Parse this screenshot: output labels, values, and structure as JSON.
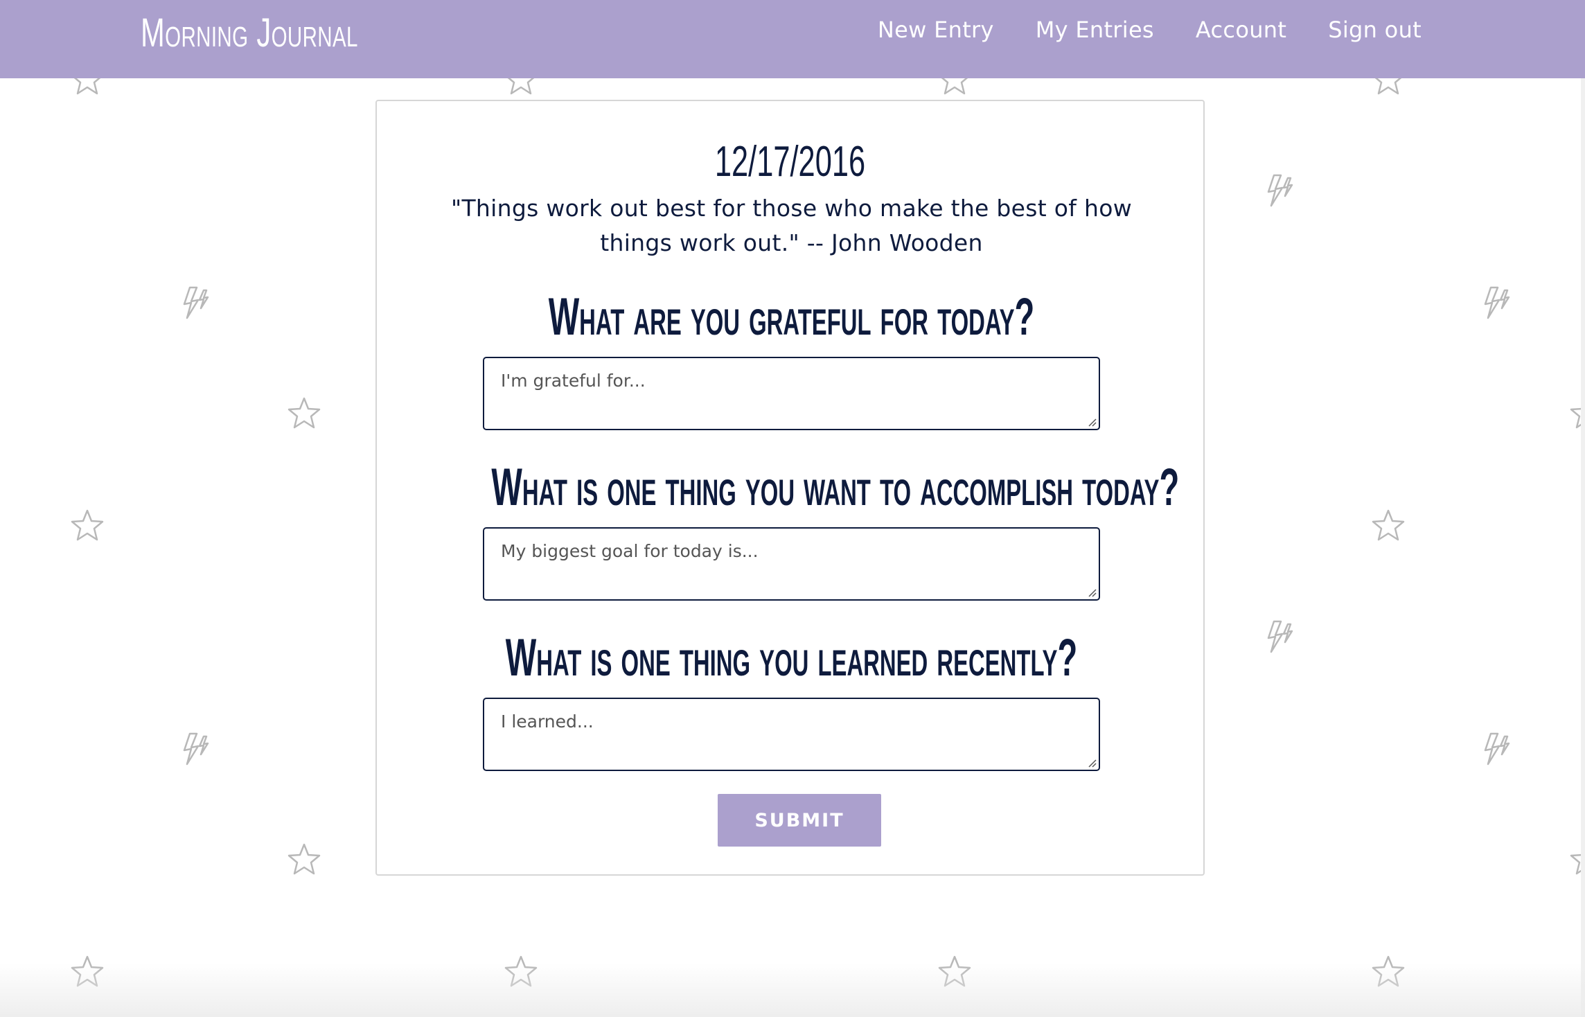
{
  "app": {
    "title": "Morning Journal"
  },
  "nav": {
    "items": [
      {
        "label": "New Entry"
      },
      {
        "label": "My Entries"
      },
      {
        "label": "Account"
      },
      {
        "label": "Sign out"
      }
    ]
  },
  "entry": {
    "date": "12/17/2016",
    "quote": "\"Things work out best for those who make the best of how things work out.\" -- John Wooden",
    "questions": [
      {
        "prompt": "What are you grateful for today?",
        "placeholder": "I'm grateful for...",
        "value": ""
      },
      {
        "prompt": "What is one thing you want to accomplish today?",
        "placeholder": "My biggest goal for today is...",
        "value": ""
      },
      {
        "prompt": "What is one thing you learned recently?",
        "placeholder": "I learned...",
        "value": ""
      }
    ],
    "submit_label": "SUBMIT"
  },
  "colors": {
    "accent": "#aba0cd",
    "text": "#0e1b3d",
    "pattern": "#b8b8b8"
  },
  "icons": {
    "pattern": [
      "star-icon",
      "lightning-icon"
    ]
  }
}
